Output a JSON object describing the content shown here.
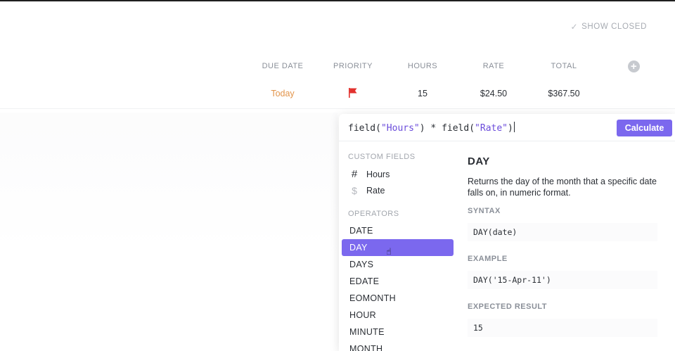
{
  "toolbar": {
    "show_closed_label": "SHOW CLOSED",
    "show_closed_icon": "check-icon"
  },
  "table": {
    "columns": [
      "DUE DATE",
      "PRIORITY",
      "HOURS",
      "RATE",
      "TOTAL"
    ],
    "row": {
      "due_date": "Today",
      "priority_icon": "red-flag-icon",
      "hours": "15",
      "rate": "$24.50",
      "total": "$367.50"
    }
  },
  "formula_editor": {
    "formula_parts": [
      "field(",
      "\"Hours\"",
      ") * field(",
      "\"Rate\"",
      ")"
    ],
    "calculate_label": "Calculate",
    "custom_fields_label": "CUSTOM FIELDS",
    "custom_fields": [
      {
        "label": "Hours",
        "icon": "number-icon"
      },
      {
        "label": "Rate",
        "icon": "dollar-icon"
      }
    ],
    "operators_label": "OPERATORS",
    "operators": [
      "DATE",
      "DAY",
      "DAYS",
      "EDATE",
      "EOMONTH",
      "HOUR",
      "MINUTE",
      "MONTH"
    ],
    "selected_operator": "DAY",
    "detail": {
      "title": "DAY",
      "description": "Returns the day of the month that a specific date falls on, in numeric format.",
      "syntax_label": "SYNTAX",
      "syntax": "DAY(date)",
      "example_label": "EXAMPLE",
      "example": "DAY('15-Apr-11')",
      "result_label": "EXPECTED RESULT",
      "result": "15"
    }
  },
  "colors": {
    "accent": "#7b68ee",
    "due_today": "#e2944a",
    "flag": "#e2312d"
  }
}
